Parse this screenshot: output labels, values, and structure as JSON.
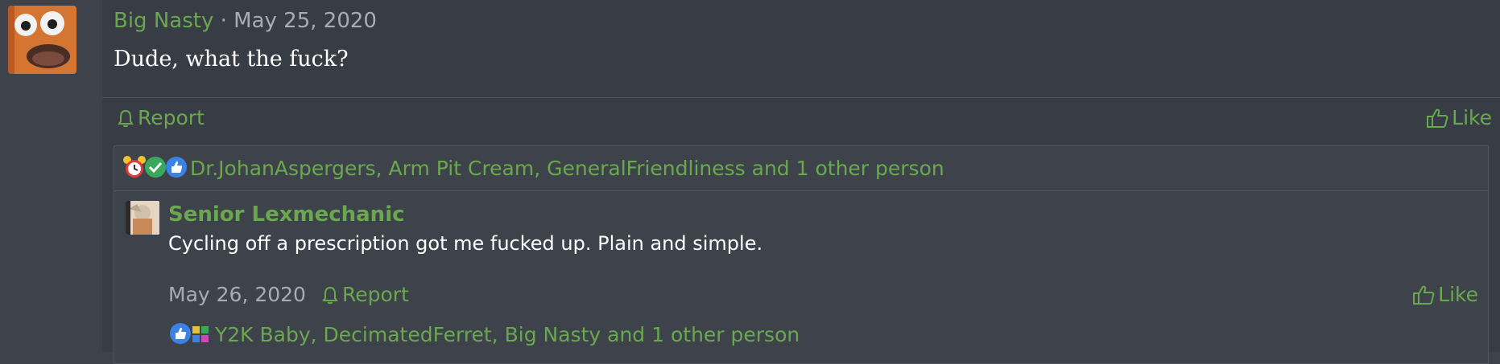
{
  "post": {
    "username": "Big Nasty",
    "separator": "·",
    "date": "May 25, 2020",
    "body": "Dude, what the fuck?",
    "report_label": "Report",
    "like_label": "Like"
  },
  "post_reactions": {
    "text": "Dr.JohanAspergers, Arm Pit Cream, GeneralFriendliness and 1 other person",
    "icons": [
      "alarm-clock-icon",
      "checkmark-icon",
      "thumbs-up-icon"
    ]
  },
  "reply": {
    "username": "Senior Lexmechanic",
    "body": "Cycling off a prescription got me fucked up. Plain and simple.",
    "date": "May 26, 2020",
    "report_label": "Report",
    "like_label": "Like"
  },
  "reply_reactions": {
    "text": "Y2K Baby, DecimatedFerret, Big Nasty and 1 other person",
    "icons": [
      "thumbs-up-icon",
      "puzzle-icon"
    ]
  },
  "colors": {
    "accent_green": "#6aa84f",
    "muted_text": "#a8adb5",
    "background": "#383c44"
  }
}
